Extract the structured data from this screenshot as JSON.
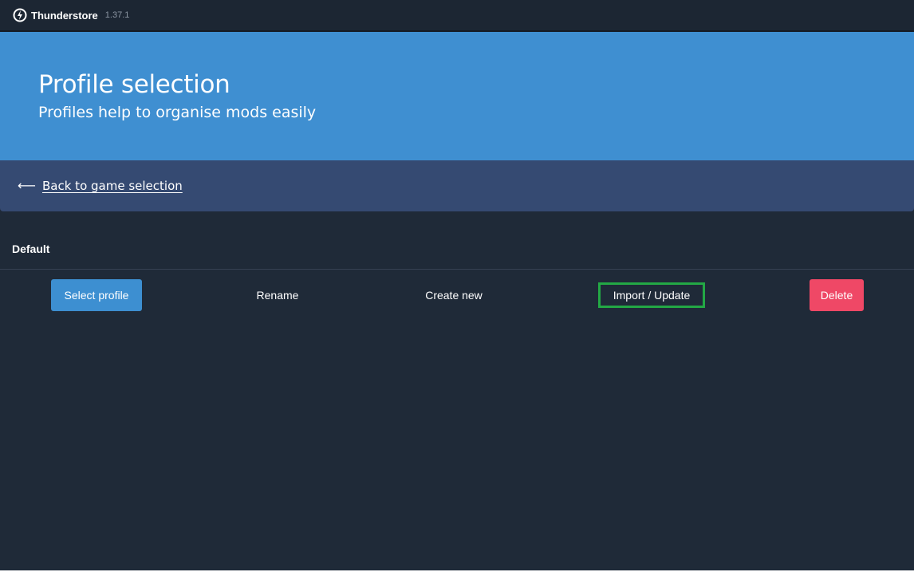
{
  "titlebar": {
    "app_name": "Thunderstore",
    "version": "1.37.1",
    "logo_icon": "thunderstore-logo-icon"
  },
  "hero": {
    "title": "Profile selection",
    "subtitle": "Profiles help to organise mods easily"
  },
  "navigation": {
    "back_icon": "arrow-left-icon",
    "back_label": "Back to game selection"
  },
  "profile": {
    "name": "Default"
  },
  "actions": {
    "select_label": "Select profile",
    "rename_label": "Rename",
    "create_label": "Create new",
    "import_label": "Import / Update",
    "delete_label": "Delete"
  },
  "colors": {
    "hero_bg": "#3f8fd1",
    "backbar_bg": "#354a72",
    "page_bg": "#1f2a38",
    "primary_button": "#3d8fd1",
    "danger_button": "#ef4866",
    "focus_outline": "#23a845"
  }
}
